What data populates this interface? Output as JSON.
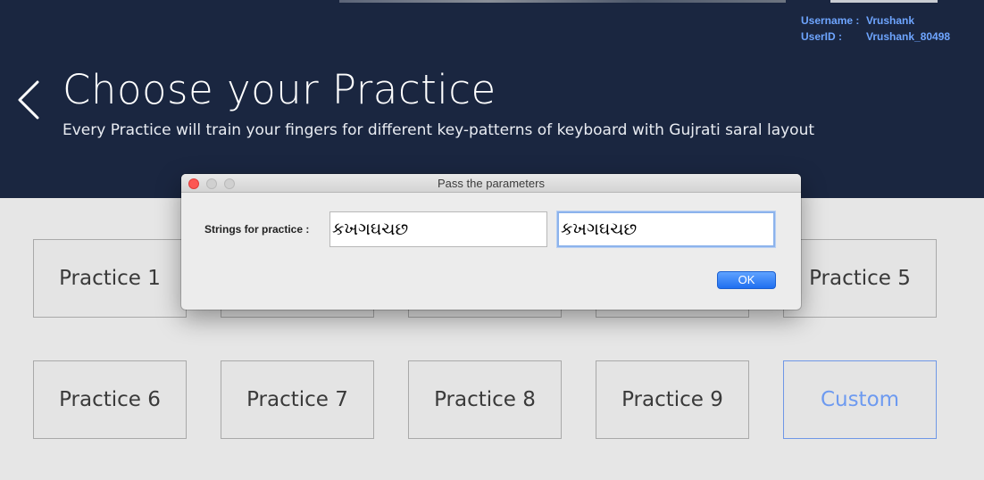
{
  "header": {
    "title": "Choose your Practice",
    "subtitle": "Every Practice will train your fingers for different key-patterns of keyboard with Gujrati saral layout",
    "back_icon": "chevron-left-icon"
  },
  "user": {
    "username_label": "Username :",
    "username_value": "Vrushank",
    "userid_label": "UserID :",
    "userid_value": "Vrushank_80498"
  },
  "practices": [
    {
      "label": "Practice 1"
    },
    {
      "label": "Practice 5"
    },
    {
      "label": "Practice 6"
    },
    {
      "label": "Practice 7"
    },
    {
      "label": "Practice 8"
    },
    {
      "label": "Practice 9"
    },
    {
      "label": "Custom"
    }
  ],
  "dialog": {
    "title": "Pass the parameters",
    "field_label": "Strings for practice :",
    "input_1_value": "કખગઘચછ",
    "input_2_value": "કખગઘચછ",
    "ok_label": "OK"
  },
  "colors": {
    "header_bg": "#1a2640",
    "user_info": "#6ea5ff",
    "custom_accent": "#6d9af0",
    "ok_button": "#1f6ff0",
    "close_traffic": "#fc5753"
  }
}
